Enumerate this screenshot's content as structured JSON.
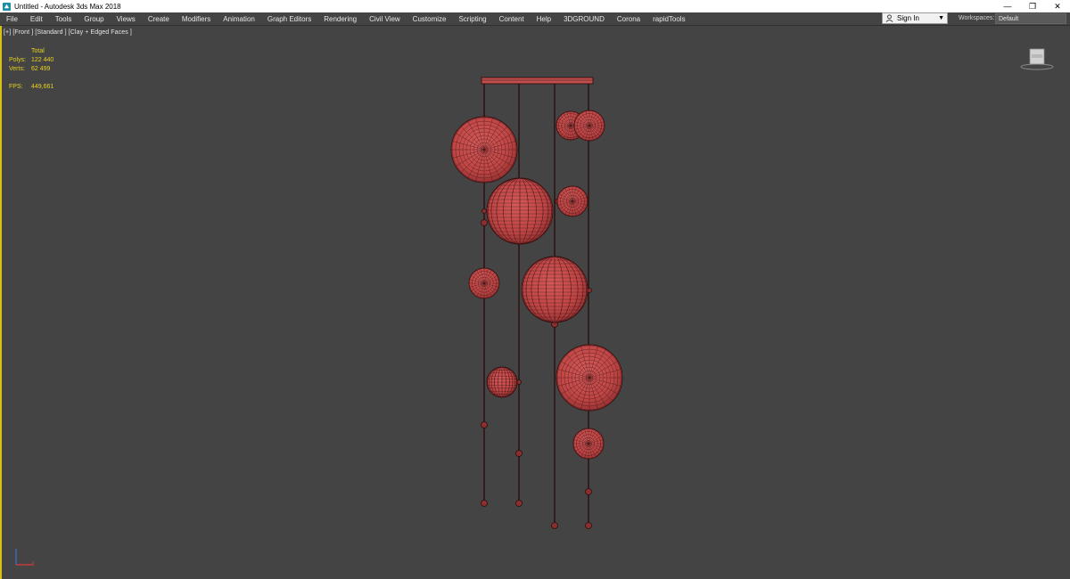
{
  "window": {
    "title": "Untitled - Autodesk 3ds Max 2018",
    "controls": {
      "minimize": "—",
      "restore": "❐",
      "close": "✕"
    }
  },
  "menu": {
    "items": [
      "File",
      "Edit",
      "Tools",
      "Group",
      "Views",
      "Create",
      "Modifiers",
      "Animation",
      "Graph Editors",
      "Rendering",
      "Civil View",
      "Customize",
      "Scripting",
      "Content",
      "Help",
      "3DGROUND",
      "Corona",
      "rapidTools"
    ]
  },
  "account": {
    "sign_in": "Sign In"
  },
  "workspaces": {
    "label": "Workspaces:",
    "value": "Default"
  },
  "viewport": {
    "label": "[+] [Front ] [Standard ] [Clay + Edged Faces ]",
    "stats": {
      "header": "Total",
      "polys_label": "Polys:",
      "polys_value": "122 440",
      "verts_label": "Verts:",
      "verts_value": "62 499",
      "fps_label": "FPS:",
      "fps_value": "449,661"
    }
  },
  "colors": {
    "viewport_bg": "#444444",
    "active_border": "#d8c21a",
    "stats_text": "#e8d21f",
    "object_red": "#c94a4a",
    "wire": "#3a1212"
  },
  "icons": {
    "app": "3dsmax-app-icon",
    "user": "user-icon",
    "caret": "chevron-down-icon",
    "viewcube": "viewcube-icon",
    "axis": "axis-tripod-icon"
  }
}
